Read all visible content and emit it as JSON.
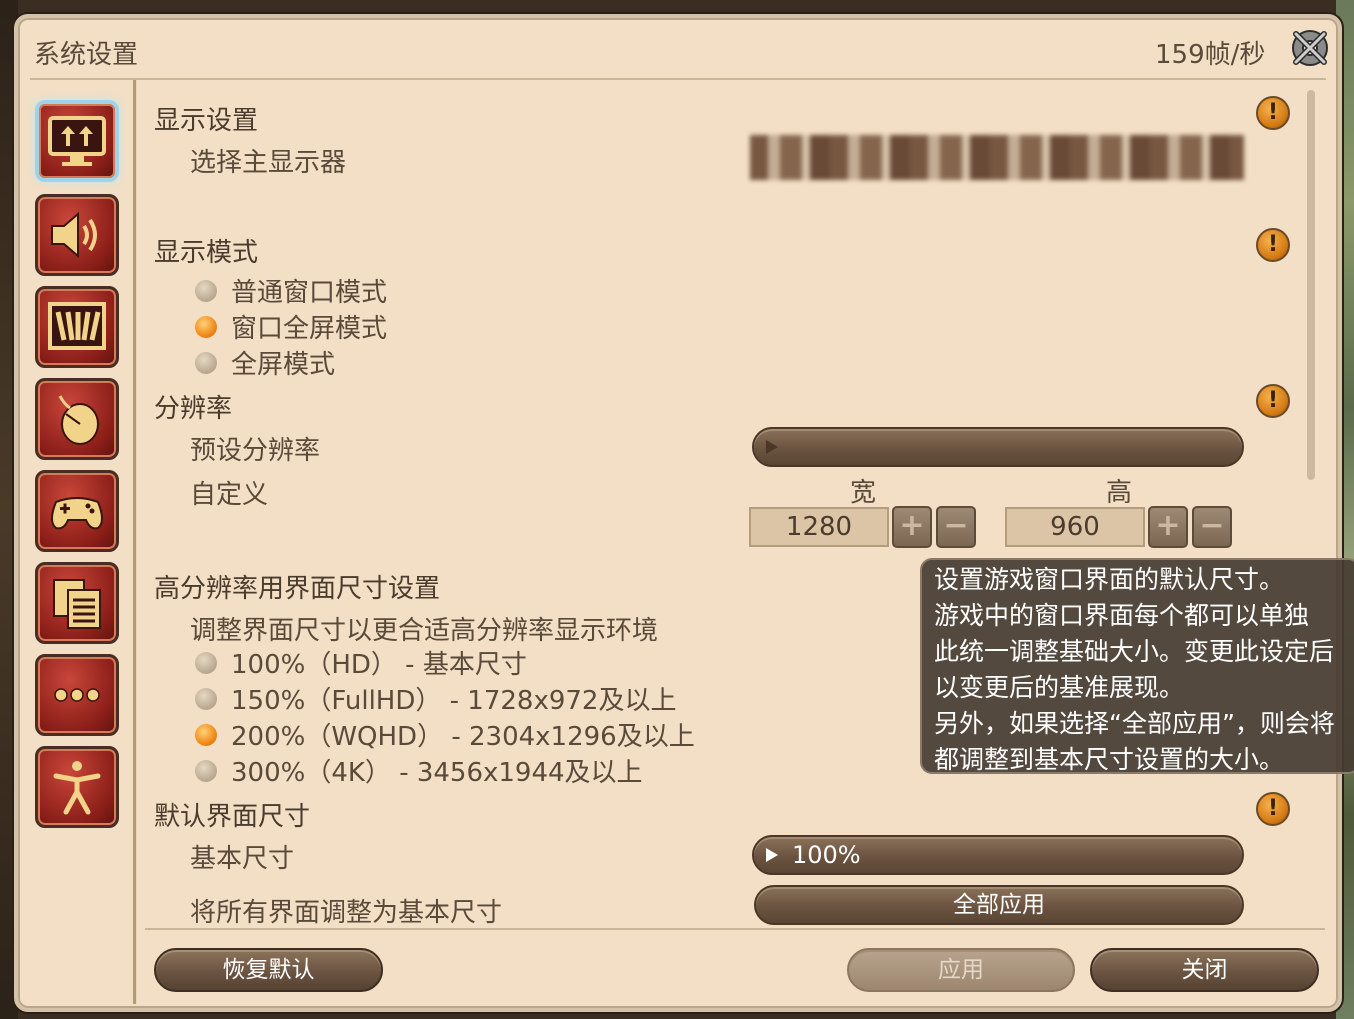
{
  "window": {
    "title": "系统设置",
    "fps": "159帧/秒"
  },
  "sidebar": {
    "items": [
      {
        "icon": "monitor-icon",
        "active": true
      },
      {
        "icon": "speaker-icon",
        "active": false
      },
      {
        "icon": "graphics-icon",
        "active": false
      },
      {
        "icon": "mouse-icon",
        "active": false
      },
      {
        "icon": "gamepad-icon",
        "active": false
      },
      {
        "icon": "document-list-icon",
        "active": false
      },
      {
        "icon": "more-icon",
        "active": false
      },
      {
        "icon": "accessibility-icon",
        "active": false
      }
    ]
  },
  "display": {
    "section_title": "显示设置",
    "primary_monitor_label": "选择主显示器"
  },
  "display_mode": {
    "section_title": "显示模式",
    "options": [
      {
        "label": "普通窗口模式",
        "selected": false
      },
      {
        "label": "窗口全屏模式",
        "selected": true
      },
      {
        "label": "全屏模式",
        "selected": false
      }
    ]
  },
  "resolution": {
    "section_title": "分辨率",
    "preset_label": "预设分辨率",
    "custom_label": "自定义",
    "width_label": "宽",
    "height_label": "高",
    "width_value": "1280",
    "height_value": "960",
    "plus": "+",
    "minus": "−"
  },
  "hires": {
    "section_title": "高分辨率用界面尺寸设置",
    "description": "调整界面尺寸以更合适高分辨率显示环境",
    "options": [
      {
        "label": "100%（HD） - 基本尺寸",
        "selected": false
      },
      {
        "label": "150%（FullHD） - 1728x972及以上",
        "selected": false
      },
      {
        "label": "200%（WQHD） - 2304x1296及以上",
        "selected": true
      },
      {
        "label": "300%（4K） - 3456x1944及以上",
        "selected": false
      }
    ]
  },
  "default_ui": {
    "section_title": "默认界面尺寸",
    "base_size_label": "基本尺寸",
    "base_size_value": "100%",
    "apply_all_label": "将所有界面调整为基本尺寸",
    "apply_all_button": "全部应用"
  },
  "tooltip": {
    "lines": [
      "设置游戏窗口界面的默认尺寸。",
      "游戏中的窗口界面每个都可以单独",
      "此统一调整基础大小。变更此设定后",
      "以变更后的基准展现。",
      "另外，如果选择“全部应用”，则会将",
      "都调整到基本尺寸设置的大小。"
    ]
  },
  "footer": {
    "reset_button": "恢复默认",
    "apply_button": "应用",
    "close_button": "关闭"
  },
  "warn_symbol": "!"
}
